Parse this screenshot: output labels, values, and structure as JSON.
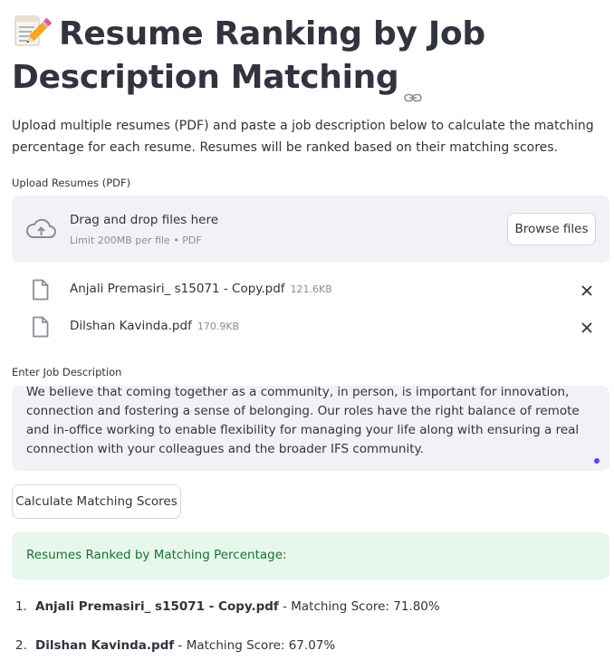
{
  "page": {
    "title": "Resume Ranking by Job Description Matching",
    "title_emoji": "memo-icon",
    "description": "Upload multiple resumes (PDF) and paste a job description below to calculate the matching percentage for each resume. Resumes will be ranked based on their matching scores."
  },
  "uploader": {
    "label": "Upload Resumes (PDF)",
    "drop_title": "Drag and drop files here",
    "drop_subtitle": "Limit 200MB per file • PDF",
    "browse_label": "Browse files",
    "files": [
      {
        "name": "Anjali Premasiri_ s15071 - Copy.pdf",
        "size": "121.6KB"
      },
      {
        "name": "Dilshan Kavinda.pdf",
        "size": "170.9KB"
      }
    ]
  },
  "job_description": {
    "label": "Enter Job Description",
    "value": "We believe that coming together as a community, in person, is important for innovation, connection and fostering a sense of belonging. Our roles have the right balance of remote and in-office working to enable flexibility for managing your life along with ensuring a real connection with your colleagues and the broader IFS community."
  },
  "actions": {
    "calculate_label": "Calculate Matching Scores"
  },
  "results": {
    "success_message": "Resumes Ranked by Matching Percentage:",
    "score_prefix": " - Matching Score: ",
    "items": [
      {
        "rank": "1.",
        "name": "Anjali Premasiri_ s15071 - Copy.pdf",
        "score": "71.80%"
      },
      {
        "rank": "2.",
        "name": "Dilshan Kavinda.pdf",
        "score": "67.07%"
      }
    ]
  },
  "colors": {
    "text": "#31333f",
    "secondary_bg": "#f0f2f6",
    "success_bg": "#e8f7ec",
    "success_text": "#177233",
    "muted": "#8a8d97"
  }
}
